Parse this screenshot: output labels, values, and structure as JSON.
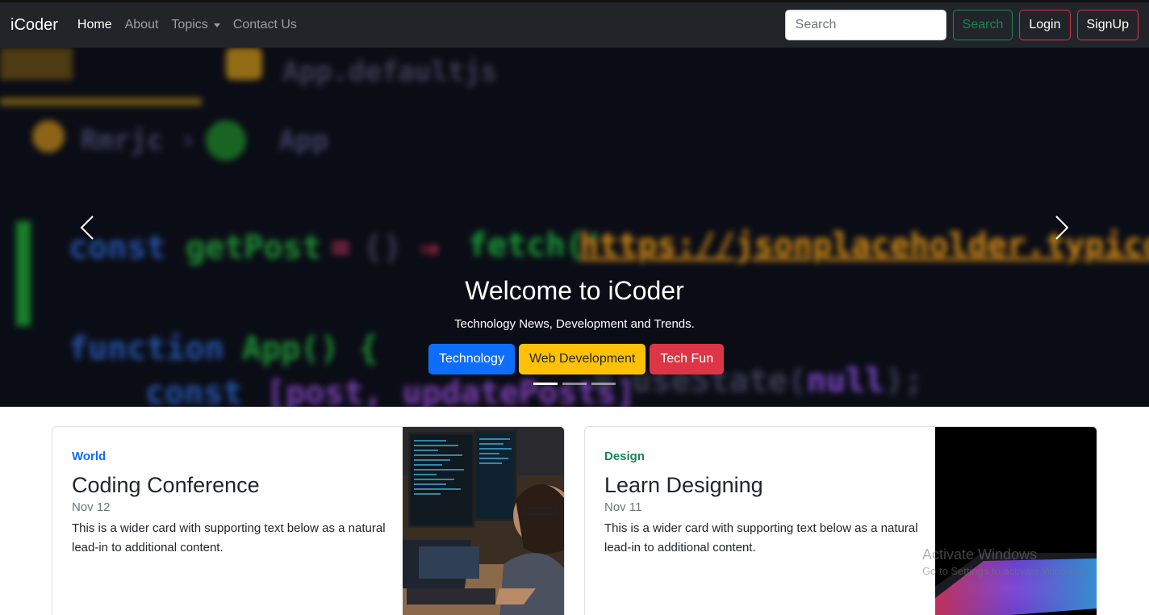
{
  "navbar": {
    "brand": "iCoder",
    "links": [
      {
        "label": "Home",
        "active": true
      },
      {
        "label": "About",
        "active": false
      },
      {
        "label": "Topics",
        "active": false,
        "dropdown": true
      },
      {
        "label": "Contact Us",
        "active": false
      }
    ],
    "search": {
      "placeholder": "Search",
      "value": ""
    },
    "search_button": "Search",
    "login_button": "Login",
    "signup_button": "SignUp"
  },
  "hero": {
    "title": "Welcome to iCoder",
    "subtitle": "Technology News, Development and Trends.",
    "buttons": [
      "Technology",
      "Web Development",
      "Tech Fun"
    ],
    "active_slide": 1,
    "slide_count": 3,
    "background_code": {
      "url": "https://jsonplaceholder.typicode.com/posts",
      "fetch": "fetch('",
      "lines": [
        "App.defaultjs",
        "App",
        "const getPost = () =>",
        "function App() {",
        "const [post, updatePosts] = useState(null);"
      ]
    }
  },
  "cards": [
    {
      "category": "World",
      "category_color": "#0d6efd",
      "title": "Coding Conference",
      "date": "Nov 12",
      "text": "This is a wider card with supporting text below as a natural lead-in to additional content."
    },
    {
      "category": "Design",
      "category_color": "#198754",
      "title": "Learn Designing",
      "date": "Nov 11",
      "text": "This is a wider card with supporting text below as a natural lead-in to additional content."
    }
  ],
  "watermark": {
    "line1": "Activate Windows",
    "line2": "Go to Settings to activate Windows."
  },
  "colors": {
    "navbar": "#212529",
    "primary": "#0d6efd",
    "warning": "#ffc107",
    "danger": "#dc3545",
    "success": "#198754"
  }
}
